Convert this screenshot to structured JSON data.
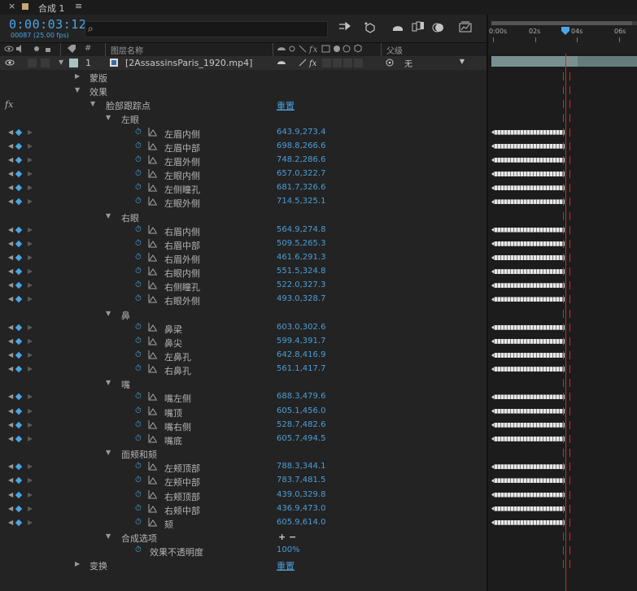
{
  "tab": {
    "close": "×",
    "title": "合成 1",
    "menu": "≡"
  },
  "toolbar": {
    "timecode": "0:00:03:12",
    "fps": "00087 (25.00 fps)",
    "search_icon": "⌕"
  },
  "ruler": {
    "ticks": [
      "0:00s",
      "02s",
      "04s",
      "06s"
    ]
  },
  "columns": {
    "layer_name": "图层名称",
    "parent": "父级",
    "number": "#"
  },
  "layer": {
    "number": "1",
    "name": "[2AssassinsParis_1920.mp4]",
    "parent_value": "无"
  },
  "tree": {
    "mask": "蒙版",
    "effects": "效果",
    "fx": "fx",
    "face_tracking": "脸部跟踪点",
    "reset": "重置",
    "transform": "变换",
    "transform_reset": "重置",
    "groups": [
      {
        "name": "左眼",
        "props": [
          {
            "name": "左眉内侧",
            "value": "643.9,273.4"
          },
          {
            "name": "左眉中部",
            "value": "698.8,266.6"
          },
          {
            "name": "左眉外侧",
            "value": "748.2,286.6"
          },
          {
            "name": "左眼内侧",
            "value": "657.0,322.7"
          },
          {
            "name": "左侧瞳孔",
            "value": "681.7,326.6"
          },
          {
            "name": "左眼外侧",
            "value": "714.5,325.1"
          }
        ]
      },
      {
        "name": "右眼",
        "props": [
          {
            "name": "右眉内侧",
            "value": "564.9,274.8"
          },
          {
            "name": "右眉中部",
            "value": "509.5,265.3"
          },
          {
            "name": "右眉外侧",
            "value": "461.6,291.3"
          },
          {
            "name": "右眼内侧",
            "value": "551.5,324.8"
          },
          {
            "name": "右侧瞳孔",
            "value": "522.0,327.3"
          },
          {
            "name": "右眼外侧",
            "value": "493.0,328.7"
          }
        ]
      },
      {
        "name": "鼻",
        "props": [
          {
            "name": "鼻梁",
            "value": "603.0,302.6"
          },
          {
            "name": "鼻尖",
            "value": "599.4,391.7"
          },
          {
            "name": "左鼻孔",
            "value": "642.8,416.9"
          },
          {
            "name": "右鼻孔",
            "value": "561.1,417.7"
          }
        ]
      },
      {
        "name": "嘴",
        "props": [
          {
            "name": "嘴左侧",
            "value": "688.3,479.6"
          },
          {
            "name": "嘴顶",
            "value": "605.1,456.0"
          },
          {
            "name": "嘴右侧",
            "value": "528.7,482.6"
          },
          {
            "name": "嘴底",
            "value": "605.7,494.5"
          }
        ]
      },
      {
        "name": "面颊和颏",
        "props": [
          {
            "name": "左颊顶部",
            "value": "788.3,344.1"
          },
          {
            "name": "左颊中部",
            "value": "783.7,481.5"
          },
          {
            "name": "右颊顶部",
            "value": "439.0,329.8"
          },
          {
            "name": "右颊中部",
            "value": "436.9,473.0"
          },
          {
            "name": "颏",
            "value": "605.9,614.0"
          }
        ]
      }
    ],
    "composite": "合成选项",
    "composite_controls": "+ −",
    "effect_opacity": "效果不透明度",
    "effect_opacity_value": "100%"
  },
  "icons": [
    "search-icon",
    "stopwatch-icon",
    "graph-icon",
    "keyframe-diamond-icon",
    "eye-icon",
    "audio-icon",
    "lock-icon",
    "label-icon"
  ]
}
